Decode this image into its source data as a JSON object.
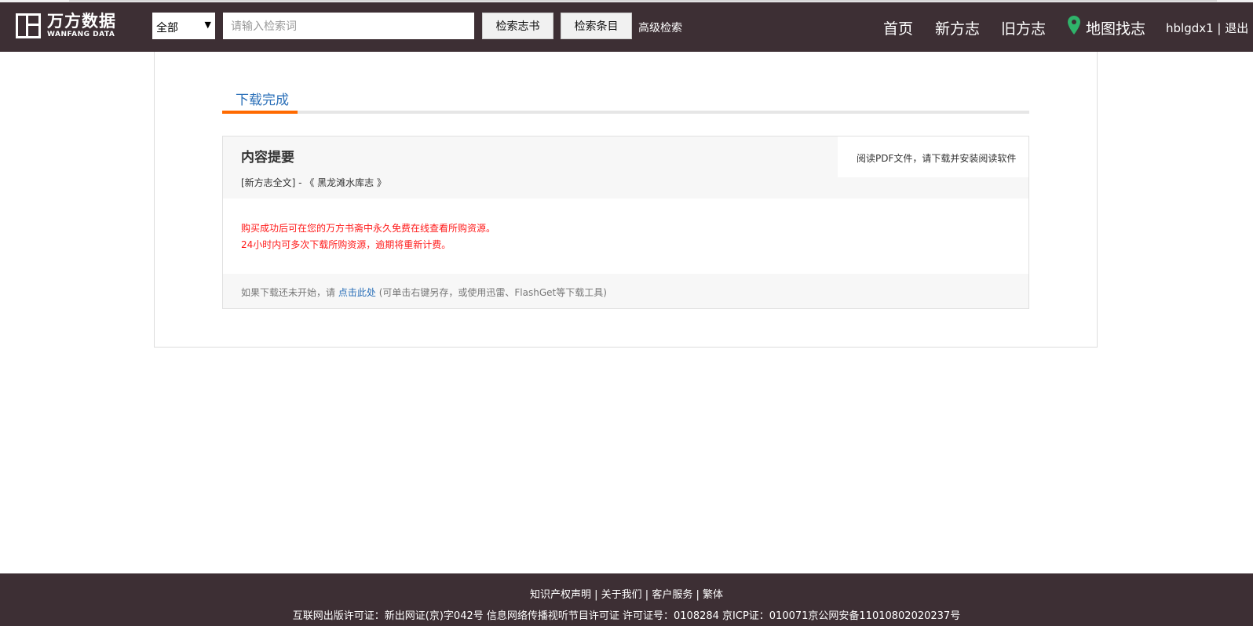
{
  "header": {
    "logo_cn": "万方数据",
    "logo_en": "WANFANG DATA",
    "select_value": "全部",
    "search_placeholder": "请输入检索词",
    "btn_search_books": "检索志书",
    "btn_search_items": "检索条目",
    "advanced_search": "高级检索",
    "nav": {
      "home": "首页",
      "new_gazetteer": "新方志",
      "old_gazetteer": "旧方志",
      "map_search": "地图找志"
    },
    "user": "hblgdx1 | 退出"
  },
  "tab": {
    "label": "下载完成"
  },
  "content": {
    "title": "内容提要",
    "subtitle": "[新方志全文] - 《 黑龙滩水库志 》",
    "pdf_note": "阅读PDF文件，请下载并安装阅读软件",
    "notice_1": "购买成功后可在您的万方书斋中永久免费在线查看所购资源。",
    "notice_2": "24小时内可多次下载所购资源，逾期将重新计费。",
    "foot_prefix": "如果下载还未开始，请",
    "foot_link": "点击此处",
    "foot_suffix": "(可单击右键另存，或使用迅雷、FlashGet等下载工具)"
  },
  "footer": {
    "links": "知识产权声明 | 关于我们 | 客户服务 | 繁体",
    "license": "互联网出版许可证：新出网证(京)字042号 信息网络传播视听节目许可证 许可证号：0108284 京ICP证：010071京公网安备11010802020237号"
  },
  "colors": {
    "header_bg": "#3d2f34",
    "accent_orange": "#ff6a00",
    "link_blue": "#2a6fb8",
    "notice_red": "#ff1a1a",
    "pin_green": "#2fb36a"
  }
}
